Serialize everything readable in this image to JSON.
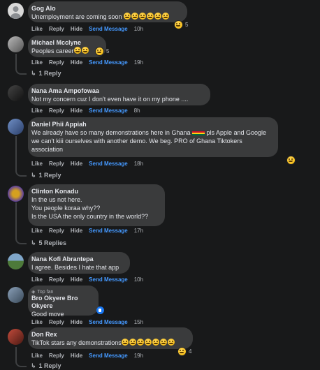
{
  "actions": {
    "like": "Like",
    "reply": "Reply",
    "hide": "Hide",
    "send": "Send Message"
  },
  "comments": [
    {
      "name": "Gog Alo",
      "text": "Unemployment are coming soon",
      "emoji_count": "😂😂😂😂😂",
      "react_count": "5",
      "time": "10h"
    },
    {
      "name": "Michael Mcclyne",
      "text": "Peoples career",
      "react_count": "5",
      "time": "19h",
      "replies": "1 Reply"
    },
    {
      "name": "Nana Ama Ampofowaa",
      "text": "Not my concern cuz I don't even have it on my phone ....",
      "time": "8h"
    },
    {
      "name": "Daniel Phii Appiah",
      "text_a": "We already have so many demonstrations here in Ghana",
      "text_b": "pls Apple and Google",
      "text_c": "we can't kiii ourselves with another demo. We beg. PRO of Ghana Tiktokers",
      "text_d": "association",
      "time": "18h",
      "replies": "1 Reply"
    },
    {
      "name": "Clinton Konadu",
      "text": "In the us not here.\nYou people koraa why??\nIs the USA the only country in the world??",
      "time": "17h",
      "replies": "5 Replies"
    },
    {
      "name": "Nana Kofi Abrantepa",
      "text": "I agree. Besides I hate that app",
      "time": "10h"
    },
    {
      "name": "Bro Okyere Bro Okyere",
      "badge": "Top fan",
      "text": "Good move",
      "time": "15h"
    },
    {
      "name": "Don Rex",
      "text": "TikTok stars any demonstrations",
      "react_count": "4",
      "time": "19h",
      "replies": "1 Reply"
    }
  ],
  "colors": {
    "background": "#18191a",
    "bubble": "#3a3b3c",
    "link": "#4599ff"
  }
}
